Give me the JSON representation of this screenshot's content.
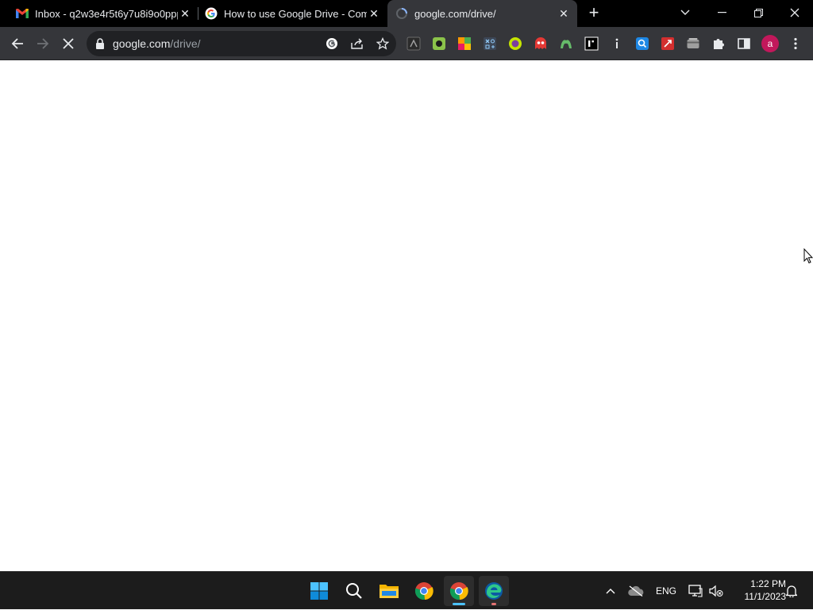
{
  "browser": {
    "tabs": [
      {
        "title": "Inbox - q2w3e4r5t6y7u8i9o0ppp",
        "favicon": "gmail-icon",
        "active": false
      },
      {
        "title": "How to use Google Drive - Com",
        "favicon": "google-icon",
        "active": false
      },
      {
        "title": "google.com/drive/",
        "favicon": "loading-icon",
        "active": true
      }
    ],
    "new_tab_label": "+",
    "omnibox": {
      "domain": "google.com",
      "path": "/drive/"
    },
    "profile_initial": "a",
    "extensions": [
      "ext-puzzle-dark-icon",
      "ext-green-icon",
      "ext-colorful-icon",
      "ext-grid-icon",
      "ext-lime-icon",
      "ext-ghost-icon",
      "ext-green-animal-icon",
      "ext-i-icon",
      "ext-info-icon",
      "ext-blue-search-icon",
      "ext-red-icon",
      "ext-card-icon"
    ]
  },
  "taskbar": {
    "apps": [
      "windows-start-icon",
      "search-icon",
      "file-explorer-icon",
      "chrome-icon",
      "chrome-active-icon",
      "edge-icon"
    ],
    "tray": {
      "language": "ENG",
      "time": "1:22 PM",
      "date": "11/1/2023"
    }
  },
  "colors": {
    "tabbar_bg": "#000000",
    "toolbar_bg": "#35363a",
    "omnibox_bg": "#202124",
    "taskbar_bg": "#1c1c1c",
    "profile_avatar": "#c2185b"
  }
}
